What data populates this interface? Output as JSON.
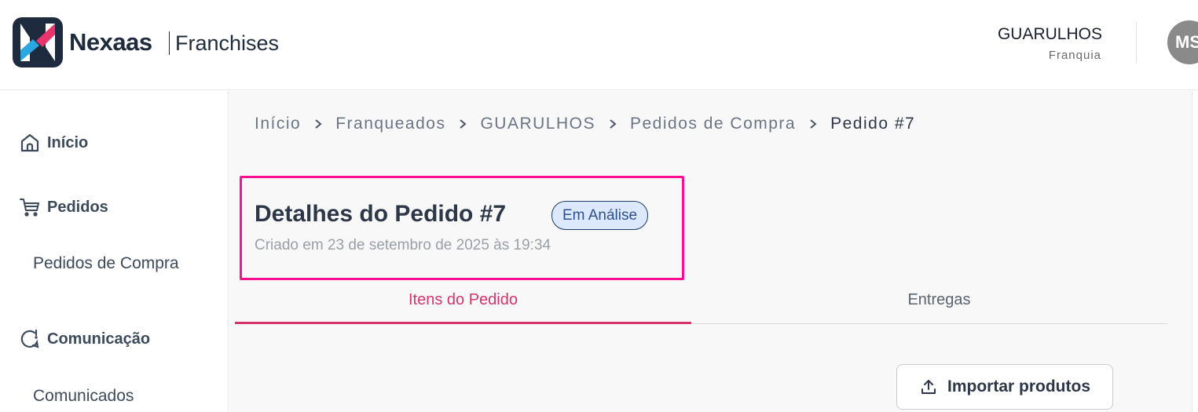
{
  "header": {
    "brand": "Nexaas",
    "brand_sub": "Franchises",
    "user_name": "GUARULHOS",
    "user_role": "Franquia",
    "avatar_initials": "MS"
  },
  "sidebar": {
    "items": [
      {
        "label": "Início",
        "icon": "home-icon"
      },
      {
        "label": "Pedidos",
        "icon": "cart-icon"
      },
      {
        "label": "Pedidos de Compra"
      },
      {
        "label": "Comunicação",
        "icon": "chat-icon"
      },
      {
        "label": "Comunicados"
      }
    ]
  },
  "breadcrumb": [
    "Início",
    "Franqueados",
    "GUARULHOS",
    "Pedidos de Compra",
    "Pedido #7"
  ],
  "order": {
    "title": "Detalhes do Pedido #7",
    "status": "Em Análise",
    "created": "Criado em 23 de setembro de 2025 às 19:34"
  },
  "tabs": [
    "Itens do Pedido",
    "Entregas"
  ],
  "actions": {
    "import_label": "Importar produtos"
  },
  "colors": {
    "accent": "#d6336c",
    "highlight": "#ff0f8f",
    "badge_bg": "#dce8fb",
    "brand_dark": "#1e2a3d"
  }
}
